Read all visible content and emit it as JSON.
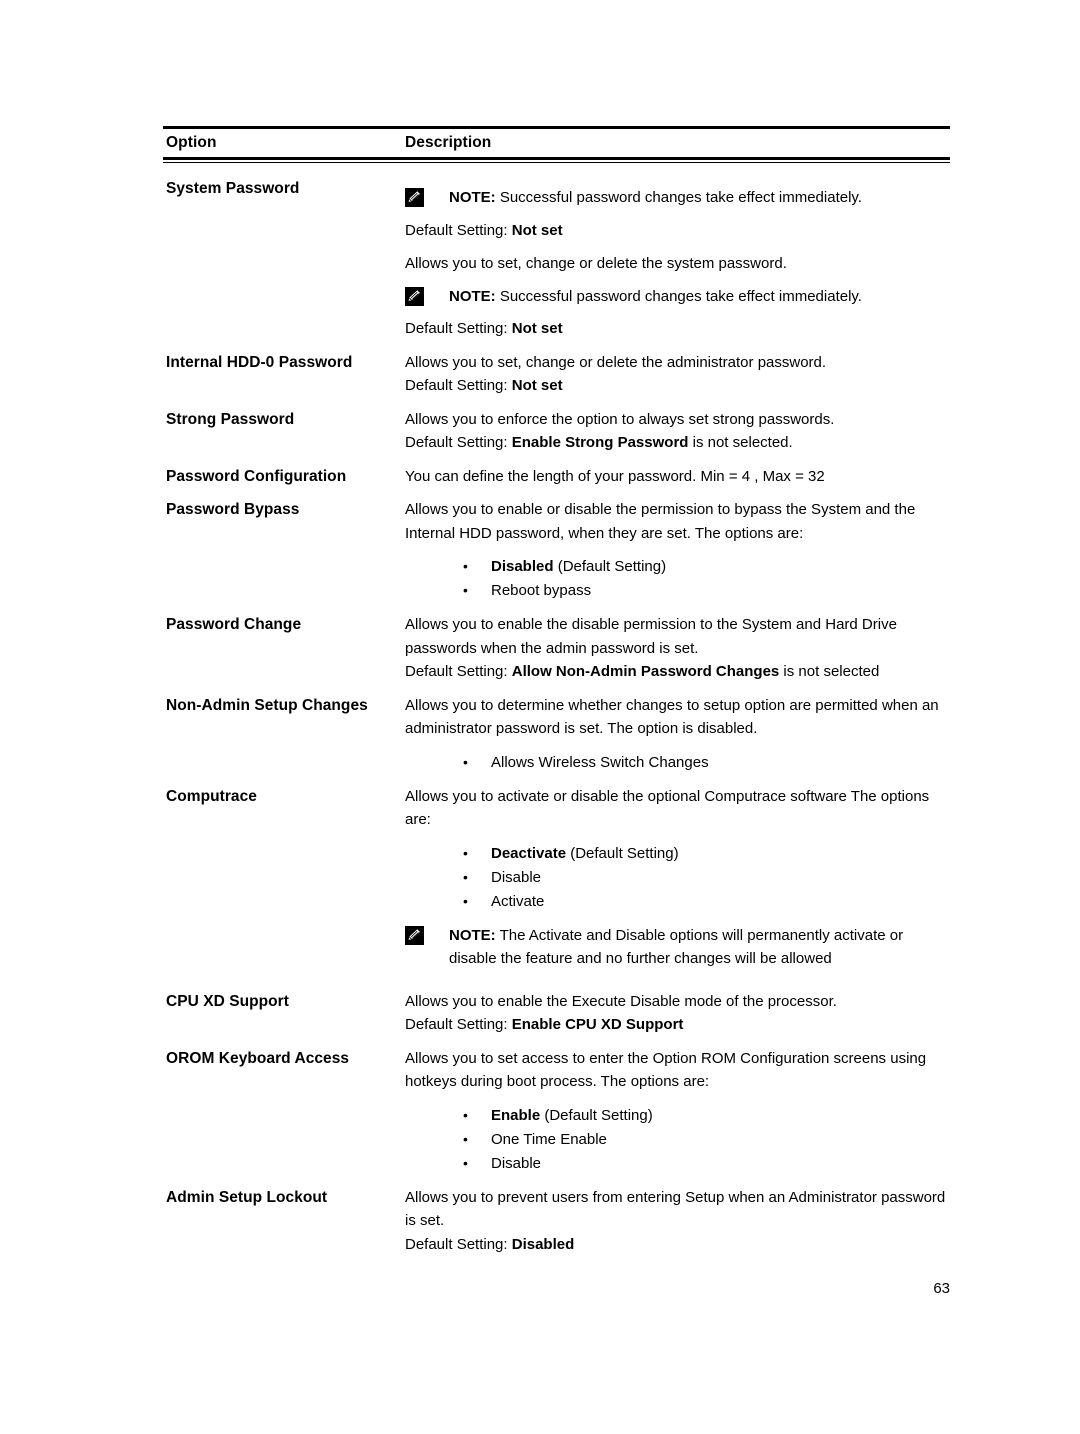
{
  "document": {
    "page_number": "63"
  },
  "table": {
    "headers": {
      "option": "Option",
      "description": "Description"
    },
    "rows": [
      {
        "option": "System Password",
        "note_1_label": "NOTE:",
        "note_1_text": " Successful password changes take effect immediately.",
        "default_label": "Default Setting: ",
        "default_value": "Not set",
        "desc": "Allows you to set, change or delete the system password.",
        "note_2_label": "NOTE:",
        "note_2_text": " Successful password changes take effect immediately.",
        "default_label_2": "Default Setting: ",
        "default_value_2": "Not set"
      },
      {
        "option": "Internal HDD-0 Password",
        "desc": "Allows you to set, change or delete the administrator password.",
        "default_label": "Default Setting: ",
        "default_value": "Not set"
      },
      {
        "option": "Strong Password",
        "desc": "Allows you to enforce the option to always set strong passwords.",
        "default_label": "Default Setting: ",
        "default_value": "Enable Strong Password",
        "default_suffix": " is not selected."
      },
      {
        "option": "Password Configuration",
        "desc": "You can define the length of your password. Min = 4 , Max = 32"
      },
      {
        "option": "Password Bypass",
        "desc": "Allows you to enable or disable the permission to bypass the System and the Internal HDD password, when they are set. The options are:",
        "bullets": [
          {
            "bold": "Disabled",
            "rest": " (Default Setting)"
          },
          {
            "bold": "",
            "rest": "Reboot bypass"
          }
        ]
      },
      {
        "option": "Password Change",
        "desc": "Allows you to enable the disable permission to the System and Hard Drive passwords when the admin password is set.",
        "default_label": "Default Setting: ",
        "default_value": "Allow Non-Admin Password Changes",
        "default_suffix": " is not selected"
      },
      {
        "option": "Non-Admin Setup Changes",
        "desc": "Allows you to determine whether changes to setup option are permitted when an administrator password is set. The option is disabled.",
        "bullets": [
          {
            "bold": "",
            "rest": "Allows Wireless Switch Changes"
          }
        ]
      },
      {
        "option": "Computrace",
        "desc": "Allows you to activate or disable the optional Computrace software The options are:",
        "bullets": [
          {
            "bold": "Deactivate",
            "rest": " (Default Setting)"
          },
          {
            "bold": "",
            "rest": "Disable"
          },
          {
            "bold": "",
            "rest": "Activate"
          }
        ],
        "note_1_label": "NOTE:",
        "note_1_text": " The Activate and Disable options will permanently activate or disable the feature and no further changes will be allowed"
      },
      {
        "option": "CPU XD Support",
        "desc": "Allows you to enable the Execute Disable mode of the processor.",
        "default_label": "Default Setting: ",
        "default_value": "Enable CPU XD Support"
      },
      {
        "option": "OROM Keyboard Access",
        "desc": "Allows you to set access to enter the Option ROM Configuration screens using hotkeys during boot process. The options are:",
        "bullets": [
          {
            "bold": "Enable",
            "rest": " (Default Setting)"
          },
          {
            "bold": "",
            "rest": "One Time Enable"
          },
          {
            "bold": "",
            "rest": "Disable"
          }
        ]
      },
      {
        "option": "Admin Setup Lockout",
        "desc": "Allows you to prevent users from entering Setup when an Administrator password is set.",
        "default_label": "Default Setting: ",
        "default_value": "Disabled"
      }
    ]
  },
  "icons": {
    "note": "note-pencil-icon"
  },
  "colors": {
    "text": "#000000",
    "rule": "#000000",
    "background": "#ffffff"
  }
}
